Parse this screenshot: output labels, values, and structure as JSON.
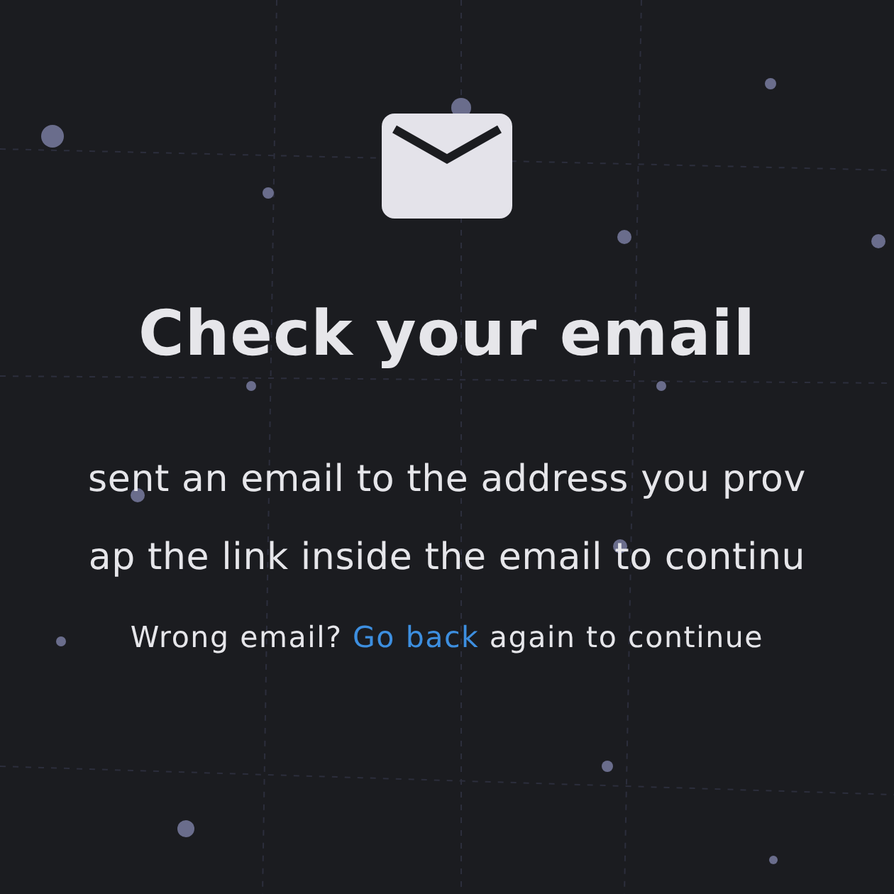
{
  "title": "Check your email",
  "message_lines": [
    "sent an email to the address you prov",
    "ap the link inside the email to continu"
  ],
  "footer": {
    "prefix": "Wrong email?",
    "link": "Go back",
    "suffix": "again to continue"
  }
}
